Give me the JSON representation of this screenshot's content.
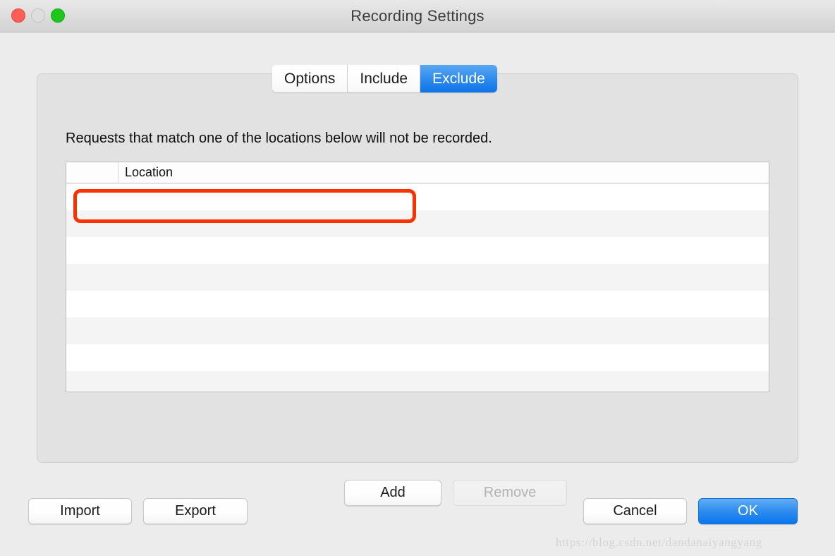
{
  "window": {
    "title": "Recording Settings",
    "traffic_lights": [
      {
        "name": "close",
        "color": "#ff5f56"
      },
      {
        "name": "minimize",
        "color": "#dedede"
      },
      {
        "name": "zoom",
        "color": "#1ec71e"
      }
    ]
  },
  "tabs": [
    {
      "label": "Options",
      "selected": false
    },
    {
      "label": "Include",
      "selected": false
    },
    {
      "label": "Exclude",
      "selected": true
    }
  ],
  "panel": {
    "description": "Requests that match one of the locations below will not be recorded.",
    "table": {
      "columns": [
        "",
        "Location"
      ],
      "rows": [],
      "empty_row_count": 8
    },
    "buttons": {
      "add": "Add",
      "remove": "Remove",
      "remove_enabled": false
    }
  },
  "footer": {
    "import": "Import",
    "export": "Export",
    "cancel": "Cancel",
    "ok": "OK"
  },
  "annotation": {
    "color": "#fa3100",
    "shape": "rounded-rectangle"
  },
  "watermark": {
    "text": "https://blog.csdn.net/dandanaiyangyang"
  }
}
